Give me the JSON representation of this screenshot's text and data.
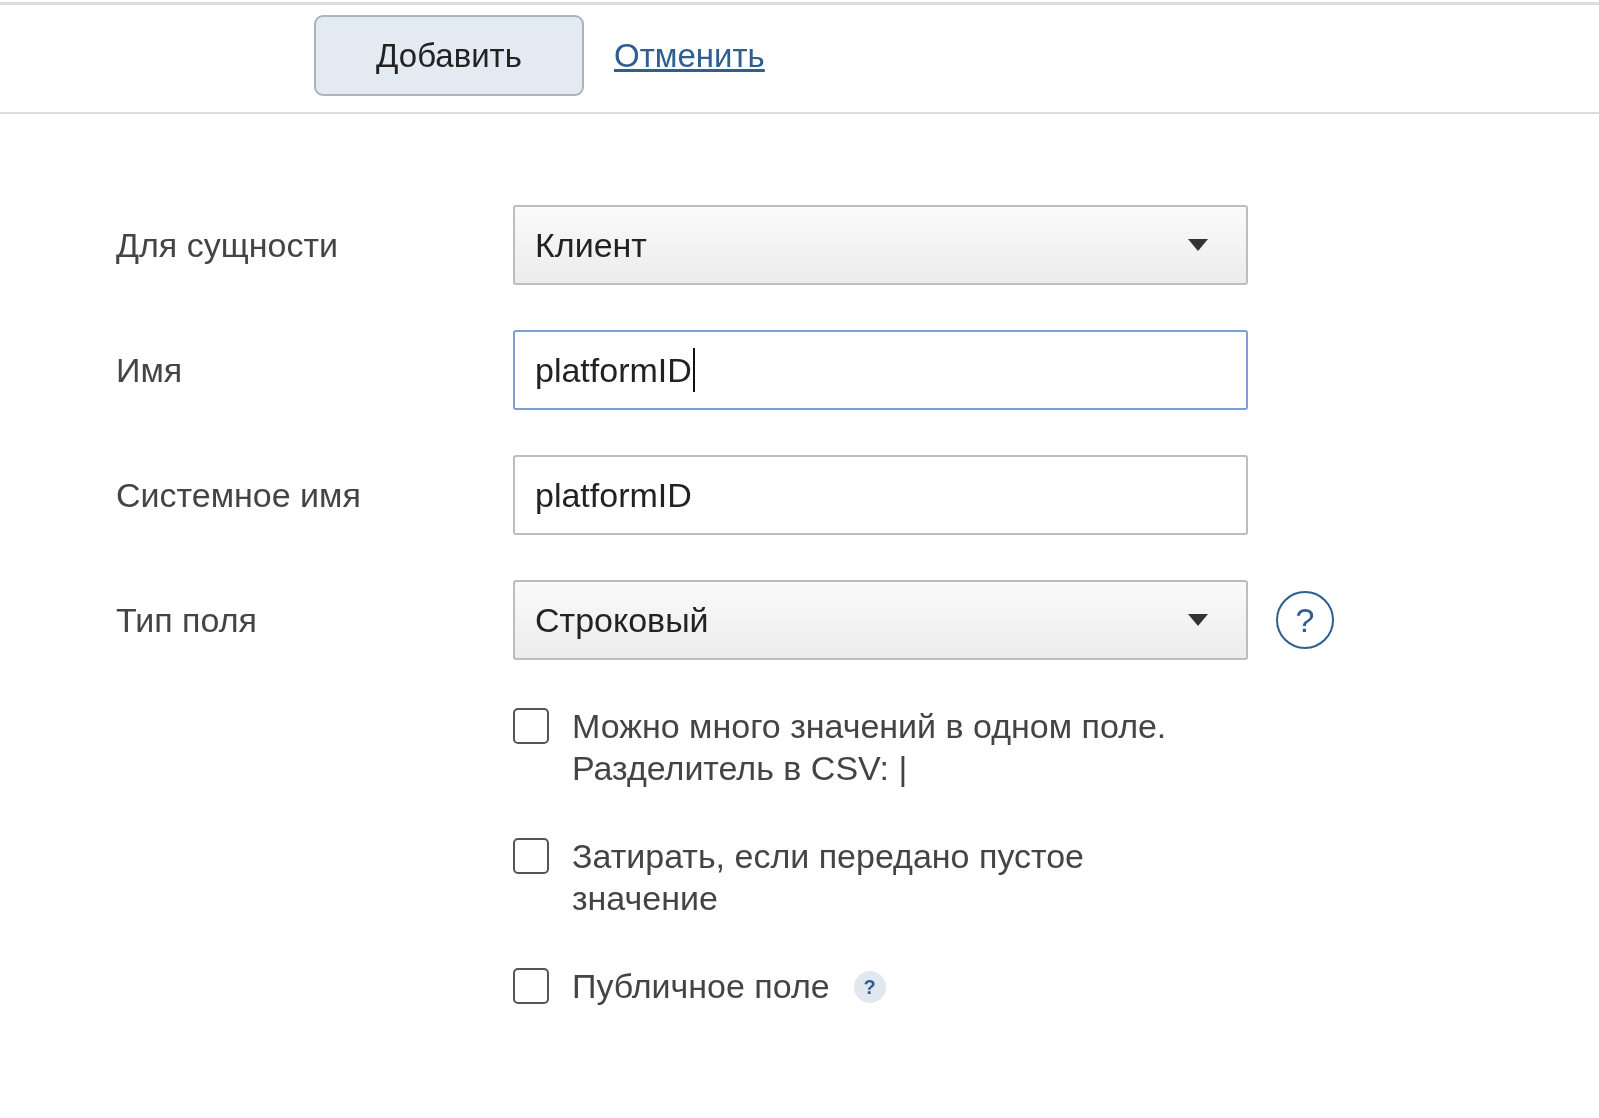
{
  "toolbar": {
    "primary_button": "Добавить",
    "cancel_link": "Отменить"
  },
  "fields": [
    {
      "kind": "select",
      "label": "Для сущности",
      "value": "Клиент",
      "focused": false,
      "help": false
    },
    {
      "kind": "text",
      "label": "Имя",
      "value": "platformID",
      "focused": true,
      "help": false
    },
    {
      "kind": "text",
      "label": "Системное имя",
      "value": "platformID",
      "focused": false,
      "help": false
    },
    {
      "kind": "select",
      "label": "Тип поля",
      "value": "Строковый",
      "focused": false,
      "help": true
    }
  ],
  "help_glyph": "?",
  "options": [
    {
      "label": "Можно много значений в одном поле. Разделитель в CSV: |",
      "checked": false,
      "help": false
    },
    {
      "label": "Затирать, если передано пустое значение",
      "checked": false,
      "help": false
    },
    {
      "label": "Публичное поле",
      "checked": false,
      "help": true
    }
  ],
  "small_help_glyph": "?"
}
